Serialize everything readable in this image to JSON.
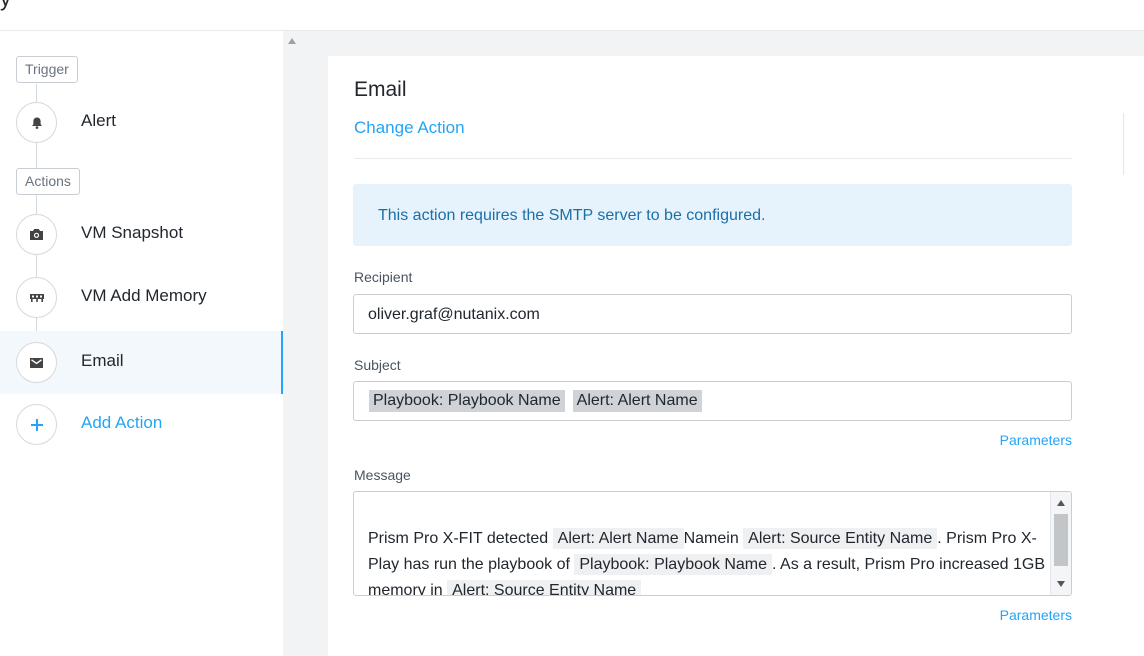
{
  "header": {
    "cut_title": "y"
  },
  "sidebar": {
    "trigger_tag": "Trigger",
    "actions_tag": "Actions",
    "steps": [
      {
        "label": "Alert",
        "icon": "bell-icon"
      },
      {
        "label": "VM Snapshot",
        "icon": "camera-icon"
      },
      {
        "label": "VM Add Memory",
        "icon": "memory-icon"
      },
      {
        "label": "Email",
        "icon": "envelope-icon"
      },
      {
        "label": "Add Action",
        "icon": "plus-icon"
      }
    ]
  },
  "main": {
    "title": "Email",
    "change_action": "Change Action",
    "notice": "This action requires the SMTP server to be configured.",
    "recipient_label": "Recipient",
    "recipient_value": "oliver.graf@nutanix.com",
    "subject_label": "Subject",
    "subject_chips": [
      "Playbook: Playbook Name",
      "Alert: Alert Name"
    ],
    "parameters_label": "Parameters",
    "message_label": "Message",
    "message": {
      "t1": "Prism Pro X-FIT detected ",
      "c1": "Alert: Alert Name",
      "t2": "Namein ",
      "c2": "Alert: Source Entity Name",
      "t3": ". Prism Pro X-Play has run the playbook of ",
      "c3": "Playbook: Playbook Name",
      "t4": ". As a result, Prism Pro increased 1GB memory in ",
      "c4": "Alert: Source Entity Name"
    }
  },
  "colors": {
    "accent": "#22a5f7",
    "notice_bg": "#e6f3fc",
    "active_bg": "#f2f8fc"
  }
}
